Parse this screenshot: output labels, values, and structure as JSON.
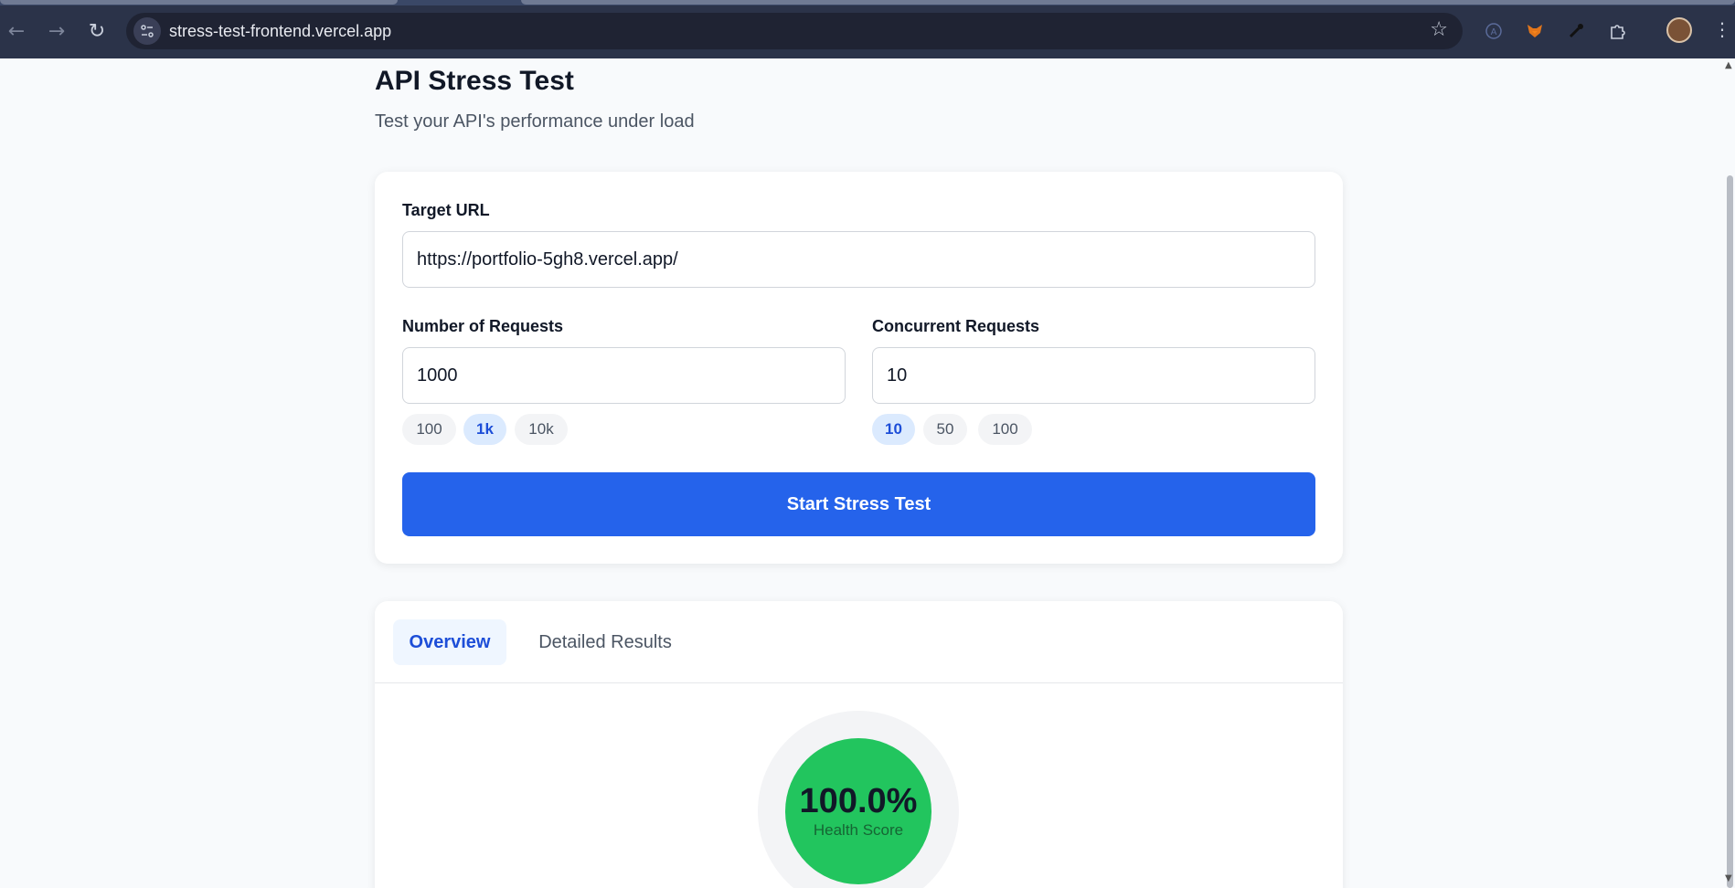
{
  "browser": {
    "url": "stress-test-frontend.vercel.app",
    "icons": {
      "back": "arrow-left-icon",
      "forward": "arrow-right-icon",
      "reload": "reload-icon",
      "site_info": "tune-icon",
      "bookmark": "star-icon",
      "extensions": [
        "accessibility-extension-icon",
        "metamask-fox-icon",
        "eyedropper-icon",
        "puzzle-extensions-icon"
      ],
      "menu": "kebab-menu-icon"
    }
  },
  "header": {
    "title": "API Stress Test",
    "subtitle": "Test your API's performance under load"
  },
  "form": {
    "target_url_label": "Target URL",
    "target_url_value": "https://portfolio-5gh8.vercel.app/",
    "requests_label": "Number of Requests",
    "requests_value": "1000",
    "requests_presets": [
      "100",
      "1k",
      "10k"
    ],
    "requests_selected": "1k",
    "concurrency_label": "Concurrent Requests",
    "concurrency_value": "10",
    "concurrency_presets": [
      "10",
      "50",
      "100"
    ],
    "concurrency_selected": "10",
    "start_button": "Start Stress Test",
    "accent_color": "#2563eb"
  },
  "results": {
    "tabs": [
      "Overview",
      "Detailed Results"
    ],
    "active_tab": "Overview",
    "health_score": "100.0%",
    "health_label": "Health Score",
    "health_color": "#22c55e"
  }
}
